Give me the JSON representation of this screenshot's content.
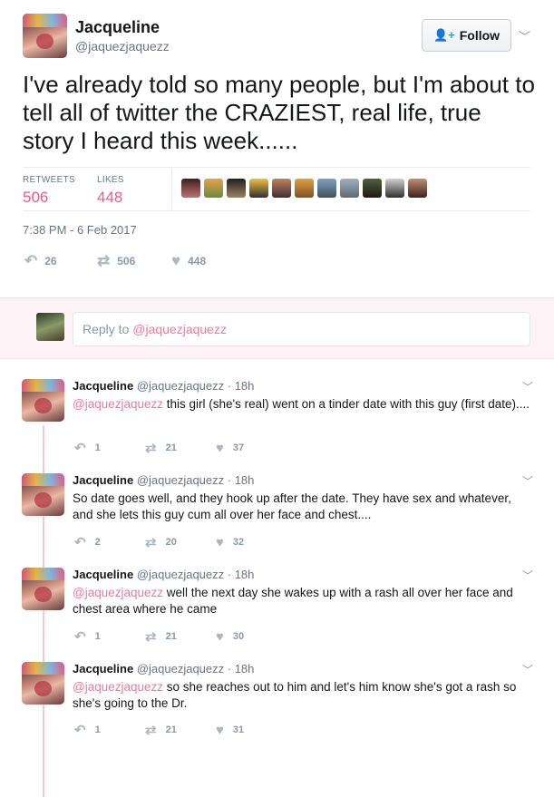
{
  "tweet": {
    "name": "Jacqueline",
    "handle": "@jaquezjaquezz",
    "follow_label": "Follow",
    "text": "I've already told so many people, but I'm about to tell all of twitter the CRAZIEST, real life, true story I heard this week......",
    "retweets_label": "RETWEETS",
    "retweets": "506",
    "likes_label": "LIKES",
    "likes": "448",
    "timestamp": "7:38 PM - 6 Feb 2017",
    "actions": {
      "replies": "26",
      "retweets": "506",
      "likes": "448"
    }
  },
  "reply_box": {
    "prefix": "Reply to ",
    "mention": "@jaquezjaquezz"
  },
  "replies": [
    {
      "name": "Jacqueline",
      "meta": "@jaquezjaquezz · 18h",
      "mention": "@jaquezjaquezz",
      "text": " this girl (she's real) went on a tinder date with this guy (first date)....",
      "replies": "1",
      "retweets": "21",
      "likes": "37"
    },
    {
      "name": "Jacqueline",
      "meta": "@jaquezjaquezz · 18h",
      "mention": "",
      "text": "So date goes well, and they hook up after the date. They have sex and whatever, and she lets this guy cum all over her face and chest....",
      "replies": "2",
      "retweets": "20",
      "likes": "32"
    },
    {
      "name": "Jacqueline",
      "meta": "@jaquezjaquezz · 18h",
      "mention": "@jaquezjaquezz",
      "text": " well the next day she wakes up with a rash all over her face and chest area where he came",
      "replies": "1",
      "retweets": "21",
      "likes": "30"
    },
    {
      "name": "Jacqueline",
      "meta": "@jaquezjaquezz · 18h",
      "mention": "@jaquezjaquezz",
      "text": " so she reaches out to him and let's him know she's got a rash so she's going to the Dr.",
      "replies": "1",
      "retweets": "21",
      "likes": "31"
    }
  ],
  "icons": {
    "reply": "reply-icon",
    "retweet": "retweet-icon",
    "like": "heart-icon",
    "caret": "chevron-down-icon",
    "follow": "add-user-icon"
  },
  "colors": {
    "mention": "#f0789a",
    "stat_value": "#e0245e",
    "reply_bg": "#fdf2f5"
  }
}
